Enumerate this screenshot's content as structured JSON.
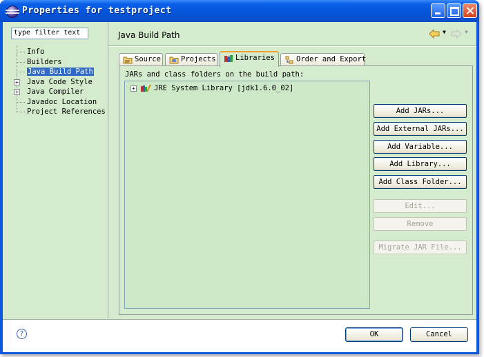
{
  "window": {
    "title": "Properties for testproject"
  },
  "left_pane": {
    "filter_placeholder": "type filter text",
    "tree": [
      {
        "label": "Info",
        "expandable": false,
        "selected": false
      },
      {
        "label": "Builders",
        "expandable": false,
        "selected": false
      },
      {
        "label": "Java Build Path",
        "expandable": false,
        "selected": true
      },
      {
        "label": "Java Code Style",
        "expandable": true,
        "selected": false
      },
      {
        "label": "Java Compiler",
        "expandable": true,
        "selected": false
      },
      {
        "label": "Javadoc Location",
        "expandable": false,
        "selected": false
      },
      {
        "label": "Project References",
        "expandable": false,
        "selected": false
      }
    ]
  },
  "right_pane": {
    "title": "Java Build Path",
    "tabs": [
      {
        "label": "Source",
        "icon": "source-folder-icon",
        "active": false
      },
      {
        "label": "Projects",
        "icon": "projects-icon",
        "active": false
      },
      {
        "label": "Libraries",
        "icon": "libraries-icon",
        "active": true
      },
      {
        "label": "Order and Export",
        "icon": "order-export-icon",
        "active": false
      }
    ],
    "list_label": "JARs and class folders on the build path:",
    "libraries": [
      {
        "label": "JRE System Library [jdk1.6.0_02]",
        "icon": "jre-library-icon"
      }
    ],
    "buttons": {
      "add_jars": "Add JARs...",
      "add_external_jars": "Add External JARs...",
      "add_variable": "Add Variable...",
      "add_library": "Add Library...",
      "add_class_folder": "Add Class Folder...",
      "edit": "Edit...",
      "remove": "Remove",
      "migrate_jar": "Migrate JAR File..."
    }
  },
  "dialog": {
    "ok": "OK",
    "cancel": "Cancel"
  },
  "colors": {
    "title_bar": "#0a5fe8",
    "pane_background": "#d4ebce",
    "selection": "#3169c6"
  }
}
